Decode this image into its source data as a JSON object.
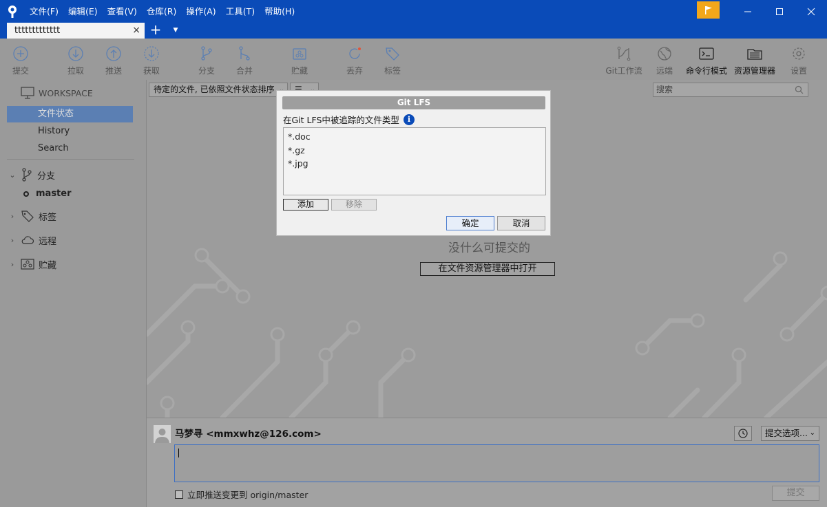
{
  "menu": [
    "文件(F)",
    "编辑(E)",
    "查看(V)",
    "仓库(R)",
    "操作(A)",
    "工具(T)",
    "帮助(H)"
  ],
  "tab": {
    "title": "ttttttttttttt",
    "close": "×",
    "add": "+",
    "menu": "▼"
  },
  "toolbar": {
    "commit": "提交",
    "pull": "拉取",
    "push": "推送",
    "fetch": "获取",
    "branch": "分支",
    "merge": "合并",
    "stash": "贮藏",
    "discard": "丢弃",
    "tag": "标签",
    "gitflow": "Git工作流",
    "remote": "远端",
    "terminal": "命令行模式",
    "explorer": "资源管理器",
    "settings": "设置"
  },
  "sidebar": {
    "workspace": "WORKSPACE",
    "items": [
      "文件状态",
      "History",
      "Search"
    ],
    "branches_label": "分支",
    "current_branch": "master",
    "tags_label": "标签",
    "remotes_label": "远程",
    "stashes_label": "贮藏"
  },
  "main": {
    "filter": "待定的文件, 已依照文件状态排序",
    "view": "☰",
    "search_placeholder": "搜索",
    "empty_message": "没什么可提交的",
    "open_explorer": "在文件资源管理器中打开"
  },
  "commit": {
    "author": "马梦寻 <mmxwhz@126.com>",
    "options": "提交选项...",
    "push_immediately": "立即推送变更到 origin/master",
    "commit_button": "提交"
  },
  "dialog": {
    "title": "Git LFS",
    "label": "在Git LFS中被追踪的文件类型",
    "info": "i",
    "items": [
      "*.doc",
      "*.gz",
      "*.jpg"
    ],
    "add": "添加",
    "remove": "移除",
    "ok": "确定",
    "cancel": "取消"
  },
  "colors": {
    "titlebar": "#0a4bb8",
    "flag": "#f3a71b",
    "selection": "#5b7fb3"
  }
}
